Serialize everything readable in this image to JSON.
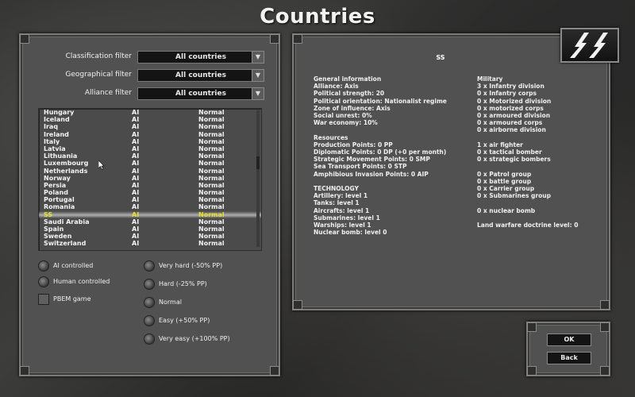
{
  "title": "Countries",
  "filters": [
    {
      "label": "Classification filter",
      "value": "All countries"
    },
    {
      "label": "Geographical filter",
      "value": "All countries"
    },
    {
      "label": "Alliance filter",
      "value": "All countries"
    }
  ],
  "countries": [
    {
      "name": "Hungary",
      "control": "AI",
      "difficulty": "Normal"
    },
    {
      "name": "Iceland",
      "control": "AI",
      "difficulty": "Normal"
    },
    {
      "name": "Iraq",
      "control": "AI",
      "difficulty": "Normal"
    },
    {
      "name": "Ireland",
      "control": "AI",
      "difficulty": "Normal"
    },
    {
      "name": "Italy",
      "control": "AI",
      "difficulty": "Normal"
    },
    {
      "name": "Latvia",
      "control": "AI",
      "difficulty": "Normal"
    },
    {
      "name": "Lithuania",
      "control": "AI",
      "difficulty": "Normal"
    },
    {
      "name": "Luxembourg",
      "control": "AI",
      "difficulty": "Normal"
    },
    {
      "name": "Netherlands",
      "control": "AI",
      "difficulty": "Normal"
    },
    {
      "name": "Norway",
      "control": "AI",
      "difficulty": "Normal"
    },
    {
      "name": "Persia",
      "control": "AI",
      "difficulty": "Normal"
    },
    {
      "name": "Poland",
      "control": "AI",
      "difficulty": "Normal"
    },
    {
      "name": "Portugal",
      "control": "AI",
      "difficulty": "Normal"
    },
    {
      "name": "Romania",
      "control": "AI",
      "difficulty": "Normal"
    },
    {
      "name": "SS",
      "control": "AI",
      "difficulty": "Normal"
    },
    {
      "name": "Saudi Arabia",
      "control": "AI",
      "difficulty": "Normal"
    },
    {
      "name": "Spain",
      "control": "AI",
      "difficulty": "Normal"
    },
    {
      "name": "Sweden",
      "control": "AI",
      "difficulty": "Normal"
    },
    {
      "name": "Switzerland",
      "control": "AI",
      "difficulty": "Normal"
    }
  ],
  "control_options": {
    "ai": "AI controlled",
    "human": "Human controlled",
    "pbem": "PBEM game"
  },
  "difficulty_options": [
    "Very hard (-50% PP)",
    "Hard (-25% PP)",
    "Normal",
    "Easy (+50% PP)",
    "Very easy (+100% PP)"
  ],
  "info": {
    "country": "SS",
    "general_header": "General information",
    "general": [
      "Alliance: Axis",
      "Political strength: 20",
      "Political orientation: Nationalist regime",
      "Zone of influence: Axis",
      "Social unrest: 0%",
      "War economy: 10%"
    ],
    "resources_header": "Resources",
    "resources": [
      "Production Points: 0 PP",
      "Diplomatic Points: 0 DP (+0 per month)",
      "Strategic Movement Points: 0 SMP",
      "Sea Transport Points: 0 STP",
      "Amphibious Invasion Points: 0 AIP"
    ],
    "technology_header": "TECHNOLOGY",
    "technology": [
      "Artillery: level 1",
      "Tanks: level 1",
      "Aircrafts: level 1",
      "Submarines: level 1",
      "Warships: level 1",
      "Nuclear bomb: level 0"
    ],
    "military_header": "Military",
    "military_ground": [
      "3 x Infantry division",
      "0 x Infantry corps",
      "0 x Motorized division",
      "0 x motorized corps",
      "0 x armoured division",
      "0 x armoured corps",
      "0 x airborne division"
    ],
    "military_air": [
      "1 x air fighter",
      "0 x tactical bomber",
      "0 x strategic bombers"
    ],
    "military_naval": [
      "0 x Patrol group",
      "0 x battle group",
      "0 x Carrier group",
      "0 x Submarines group"
    ],
    "military_nuclear": "0 x nuclear bomb",
    "doctrine": "Land warfare doctrine level: 0"
  },
  "buttons": {
    "ok": "OK",
    "back": "Back"
  },
  "colors": {
    "selected_row": "#e8e030",
    "panel": "#505150"
  }
}
